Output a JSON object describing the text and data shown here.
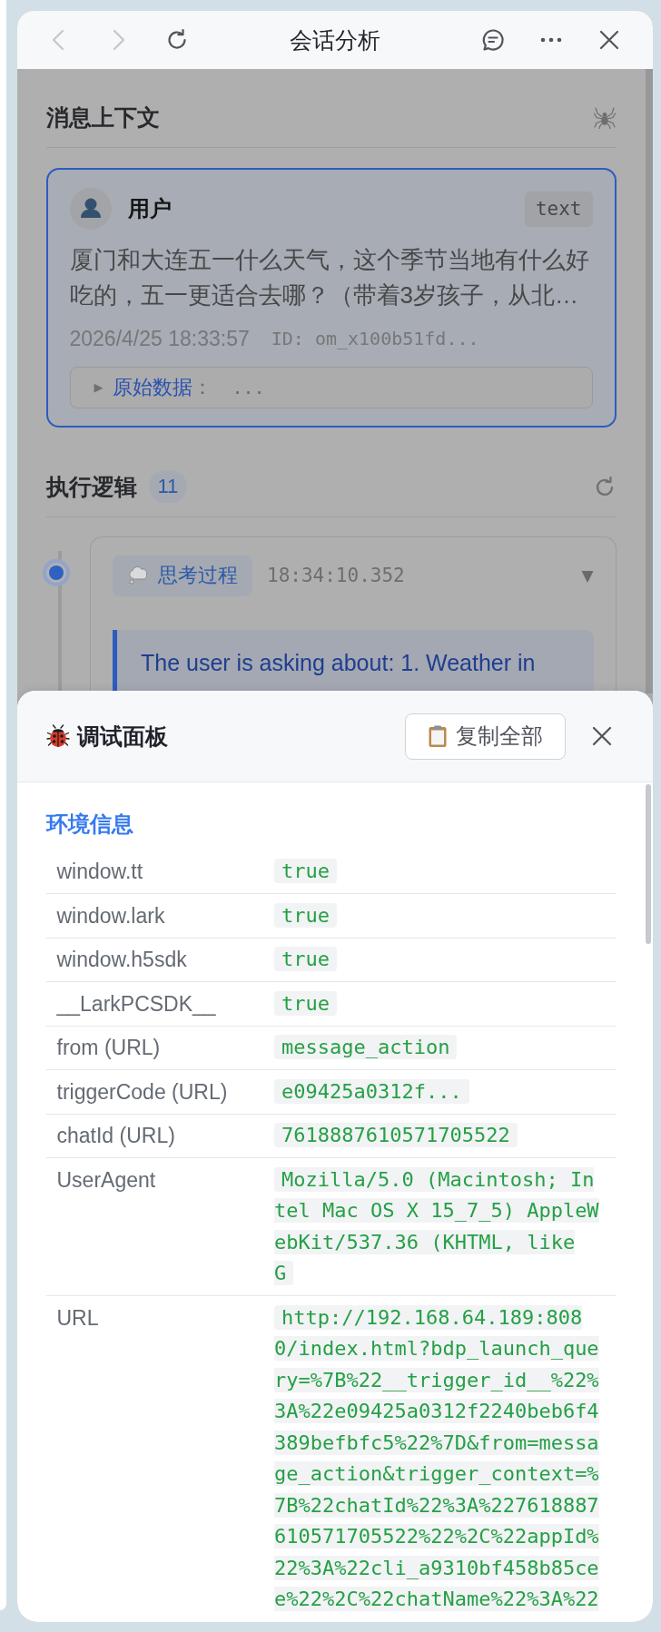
{
  "window": {
    "title": "会话分析",
    "back_button": {
      "disabled": true
    },
    "forward_button": {
      "disabled": true
    }
  },
  "message_context": {
    "title": "消息上下文",
    "message": {
      "sender": "用户",
      "type": "text",
      "text": "厦门和大连五一什么天气，这个季节当地有什么好吃的，五一更适合去哪？（带着3岁孩子，从北…",
      "timestamp": "2026/4/25 18:33:57",
      "id": "ID: om_x100b51fd...",
      "raw_data": {
        "toggle": "▶",
        "label": "原始数据",
        "separator": "：",
        "preview": "..."
      }
    }
  },
  "execution_logic": {
    "title": "执行逻辑",
    "count": "11",
    "steps": [
      {
        "kind": "thinking",
        "label": "思考过程",
        "time": "18:34:10.352",
        "toggle": "▼",
        "text": "The user is asking about: 1. Weather in"
      }
    ]
  },
  "debug_panel": {
    "title": "调试面板",
    "copy_button": "复制全部",
    "sections": [
      {
        "title": "环境信息",
        "rows": [
          {
            "key": "window.tt",
            "value": "true",
            "continues": false
          },
          {
            "key": "window.lark",
            "value": "true",
            "continues": false
          },
          {
            "key": "window.h5sdk",
            "value": "true",
            "continues": false
          },
          {
            "key": "__LarkPCSDK__",
            "value": "true",
            "continues": false
          },
          {
            "key": "from (URL)",
            "value": "message_action",
            "continues": false
          },
          {
            "key": "triggerCode (URL)",
            "value": "e09425a0312f...",
            "continues": false
          },
          {
            "key": "chatId (URL)",
            "value": "7618887610571705522",
            "continues": false
          },
          {
            "key": "UserAgent",
            "value": "Mozilla/5.0 (Macintosh; Intel Mac OS X 15_7_5) AppleWebKit/537.36 (KHTML, like G",
            "continues": false
          },
          {
            "key": "URL",
            "value": "http://192.168.64.189:8080/index.html?bdp_launch_query=%7B%22__trigger_id__%22%3A%22e09425a0312f2240beb6f4389befbfc5%22%7D&from=message_action&trigger_context=%7B%22chatId%22%3A%227618887610571705522%22%2C%22appId%22%3A%22cli_a9310bf458b85cee%22%2C%22chatName%22%3A%22",
            "continues": true
          }
        ]
      }
    ]
  }
}
